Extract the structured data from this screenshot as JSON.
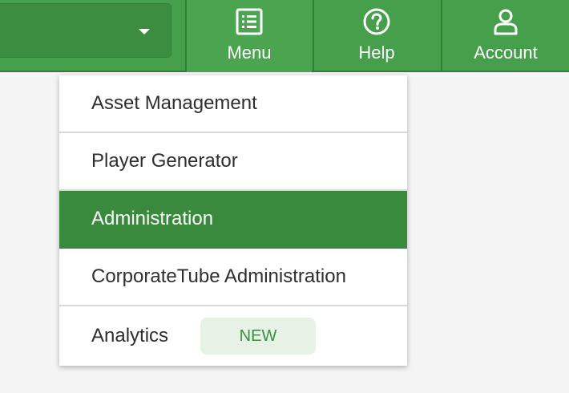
{
  "header": {
    "menu_label": "Menu",
    "help_label": "Help",
    "account_label": "Account",
    "icons": {
      "menu": "list-icon",
      "help": "question-circle-icon",
      "account": "user-icon",
      "select": "caret-down-icon"
    },
    "colors": {
      "bar": "#46a04b",
      "active_item": "#3a8a3e",
      "badge_bg": "#e6f2e6",
      "badge_text": "#3b8d3f"
    }
  },
  "menu": {
    "items": [
      {
        "label": "Asset Management"
      },
      {
        "label": "Player Generator"
      },
      {
        "label": "Administration"
      },
      {
        "label": "CorporateTube Administration"
      },
      {
        "label": "Analytics",
        "badge": "NEW"
      }
    ],
    "active_index": 2
  }
}
